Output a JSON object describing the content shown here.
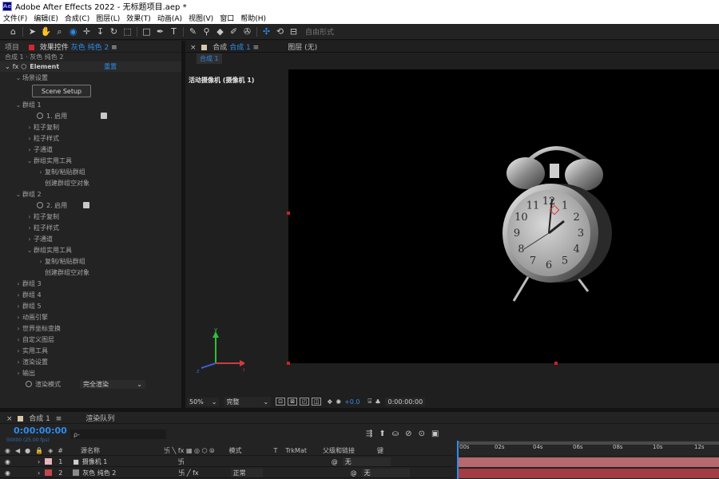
{
  "window": {
    "logo": "Ae",
    "title": "Adobe After Effects 2022 - 无标题项目.aep *"
  },
  "menu": [
    "文件(F)",
    "编辑(E)",
    "合成(C)",
    "图层(L)",
    "效果(T)",
    "动画(A)",
    "视图(V)",
    "窗口",
    "帮助(H)"
  ],
  "toolbar": {
    "freeform_label": "自由形式"
  },
  "left_panel": {
    "tab_project": "项目",
    "tab_effects_label": "效果控件",
    "tab_effects_layer": "灰色 纯色 2",
    "tab_menu": "≡",
    "breadcrumb": "合成 1 · 灰色 纯色 2",
    "effect_name": "Element",
    "reset_label": "重置",
    "scene_settings": "场景设置",
    "scene_setup_button": "Scene Setup",
    "group1": "群组 1",
    "group1_enable": "1. 启用",
    "items1": [
      "粒子复制",
      "粒子样式",
      "子通道",
      "群组实用工具"
    ],
    "sub1": [
      "复制/粘贴群组",
      "创建群组空对象"
    ],
    "group2": "群组 2",
    "group2_enable": "2. 启用",
    "items2": [
      "粒子复制",
      "粒子样式",
      "子通道",
      "群组实用工具"
    ],
    "sub2": [
      "复制/粘贴群组",
      "创建群组空对象"
    ],
    "groups_more": [
      "群组 3",
      "群组 4",
      "群组 5",
      "动画引擎",
      "世界坐标变换",
      "自定义图层",
      "实用工具",
      "渲染设置",
      "输出"
    ],
    "render_mode_label": "渲染模式",
    "render_mode_value": "完全渲染"
  },
  "comp_panel": {
    "tab_lock": "×",
    "tab_comp_prefix": "合成",
    "tab_comp_name": "合成 1",
    "tab_menu": "≡",
    "tab_layer": "图层 (无)",
    "sub_tab": "合成 1",
    "camera_label": "活动摄像机 (摄像机 1)",
    "zoom": "50%",
    "quality": "完整",
    "exposure": "+0.0",
    "time": "0:00:00:00",
    "clock_numbers": [
      "12",
      "1",
      "2",
      "3",
      "4",
      "5",
      "6",
      "7",
      "8",
      "9",
      "10",
      "11"
    ]
  },
  "timeline": {
    "tab_comp": "合成 1",
    "tab_menu": "≡",
    "tab_render": "渲染队列",
    "timecode": "0:00:00:00",
    "fps_text": "00000 (25.00 fps)",
    "search_placeholder": "ρ-",
    "columns": {
      "num": "#",
      "source": "源名称",
      "mode": "模式",
      "t": "T",
      "trkmat": "TrkMat",
      "parent": "父级和链接",
      "key": "键"
    },
    "layers": [
      {
        "num": "1",
        "name": "摄像机 1",
        "mode": "",
        "parent": "无",
        "color": "#e8b4bd"
      },
      {
        "num": "2",
        "name": "灰色 纯色 2",
        "mode": "正常",
        "parent": "无",
        "color": "#c2484e"
      }
    ],
    "ticks": [
      "00s",
      "02s",
      "04s",
      "06s",
      "08s",
      "10s",
      "12s"
    ]
  },
  "colors": {
    "accent_blue": "#2d8ceb",
    "layer1_bar": "#b66a6f",
    "layer2_bar": "#a33c43"
  }
}
